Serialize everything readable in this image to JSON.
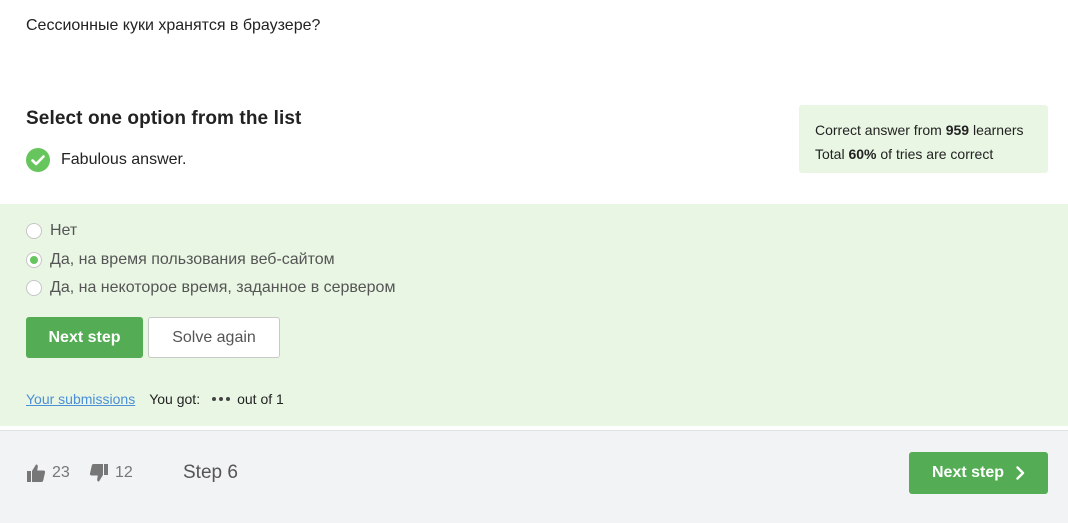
{
  "question": {
    "text": "Сессионные куки хранятся в браузере?"
  },
  "section_title": "Select one option from the list",
  "feedback": {
    "text": "Fabulous answer."
  },
  "stats": {
    "line1_prefix": "Correct answer from ",
    "learners_count": "959",
    "line1_suffix": " learners",
    "line2_prefix": "Total ",
    "percent": "60%",
    "line2_suffix": " of tries are correct"
  },
  "options": [
    {
      "label": "Нет",
      "selected": false
    },
    {
      "label": "Да, на время пользования веб-сайтом",
      "selected": true
    },
    {
      "label": "Да, на некоторое время, заданное в сервером",
      "selected": false
    }
  ],
  "buttons": {
    "next_step": "Next step",
    "solve_again": "Solve again"
  },
  "submissions": {
    "link": "Your submissions",
    "you_got": "You got:",
    "out_of": "out of 1"
  },
  "footer": {
    "likes": "23",
    "dislikes": "12",
    "step": "Step 6",
    "next_step": "Next step"
  },
  "colors": {
    "accent": "#54ad54",
    "success_bg": "#e9f6e4",
    "link": "#4b8fd6"
  }
}
